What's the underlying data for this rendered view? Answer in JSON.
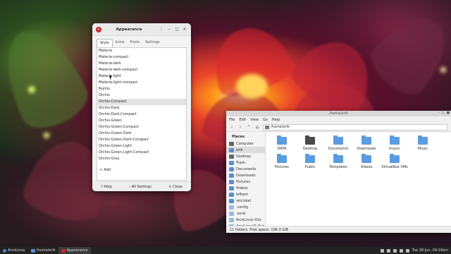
{
  "appearance": {
    "title": "Appearance",
    "logo": "A",
    "tabs": [
      "Style",
      "Icons",
      "Fonts",
      "Settings"
    ],
    "themes": [
      "Materia",
      "Materia-compact",
      "Materia-dark",
      "Materia-dark-compact",
      "Materia-light",
      "Materia-light-compact",
      "Numix",
      "Orchis",
      "Orchis-Compact",
      "Orchis-Dark",
      "Orchis-Dark-Compact",
      "Orchis-Green",
      "Orchis-Green-Compact",
      "Orchis-Green-Dark",
      "Orchis-Green-Dark-Compact",
      "Orchis-Green-Light",
      "Orchis-Green-Light-Compact",
      "Orchis-Grey"
    ],
    "selected_index": 8,
    "add_label": "Add",
    "help_label": "Help",
    "all_settings_label": "All Settings",
    "close_label": "Close"
  },
  "filemanager": {
    "title": "/home/erik",
    "menu": [
      "File",
      "Edit",
      "View",
      "Go",
      "Help"
    ],
    "location": "/home/erik",
    "places_header": "Places",
    "places": [
      "Computer",
      "erik",
      "Desktop",
      "Trash",
      "Documents",
      "Downloads",
      "Pictures",
      "Videos",
      "leftwm",
      "/etc/skel",
      ".config",
      ".local",
      "ArcoLinux-Out",
      "ArcoLinuxD-Out"
    ],
    "places_selected": 1,
    "items": [
      "DATA",
      "Desktop",
      "Documents",
      "Downloads",
      "Insync",
      "Music",
      "Pictures",
      "Public",
      "Templates",
      "Videos",
      "VirtualBox VMs"
    ],
    "status": "11 folders, Free space: 196.3 GiB"
  },
  "taskbar": {
    "items": [
      "ArcoLinux",
      "/home/erik",
      "Appearance"
    ],
    "clock": "Tue 28 Jun, 09:19am"
  }
}
